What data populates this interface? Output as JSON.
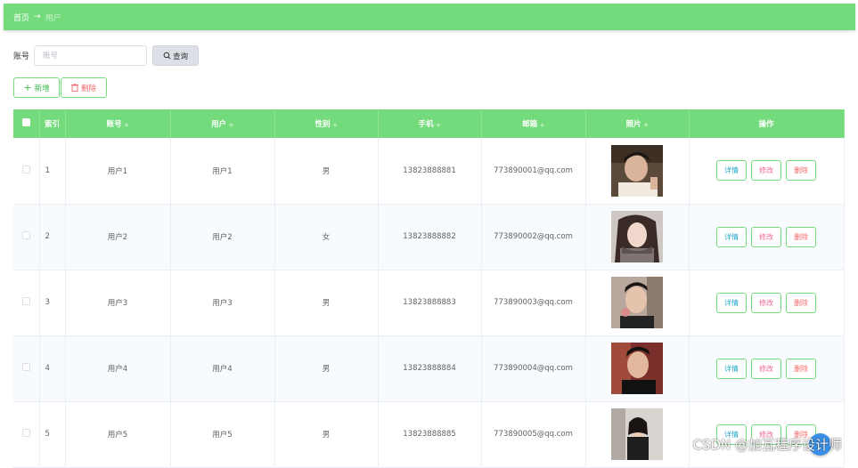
{
  "breadcrumb": {
    "home": "首页",
    "separator": "→",
    "current": "用户"
  },
  "search": {
    "label": "账号",
    "placeholder": "账号",
    "value": "",
    "button_label": "查询"
  },
  "actions": {
    "add_label": "新增",
    "delete_label": "删除"
  },
  "table": {
    "headers": {
      "index": "索引",
      "account": "账号",
      "user": "用户",
      "gender": "性别",
      "phone": "手机",
      "email": "邮箱",
      "photo": "照片",
      "ops": "操作"
    },
    "ops": {
      "detail": "详情",
      "edit": "修改",
      "delete": "删除"
    },
    "rows": [
      {
        "index": "1",
        "account": "用户1",
        "user": "用户1",
        "gender": "男",
        "phone": "13823888881",
        "email": "773890001@qq.com"
      },
      {
        "index": "2",
        "account": "用户2",
        "user": "用户2",
        "gender": "女",
        "phone": "13823888882",
        "email": "773890002@qq.com"
      },
      {
        "index": "3",
        "account": "用户3",
        "user": "用户3",
        "gender": "男",
        "phone": "13823888883",
        "email": "773890003@qq.com"
      },
      {
        "index": "4",
        "account": "用户4",
        "user": "用户4",
        "gender": "男",
        "phone": "13823888884",
        "email": "773890004@qq.com"
      },
      {
        "index": "5",
        "account": "用户5",
        "user": "用户5",
        "gender": "男",
        "phone": "13823888885",
        "email": "773890005@qq.com"
      }
    ]
  },
  "watermark": "CSDN @加瓦程序设计师",
  "colors": {
    "accent": "#74db7c",
    "detail": "#26a9c9",
    "edit": "#f06b9a",
    "delete": "#f06b6b"
  }
}
